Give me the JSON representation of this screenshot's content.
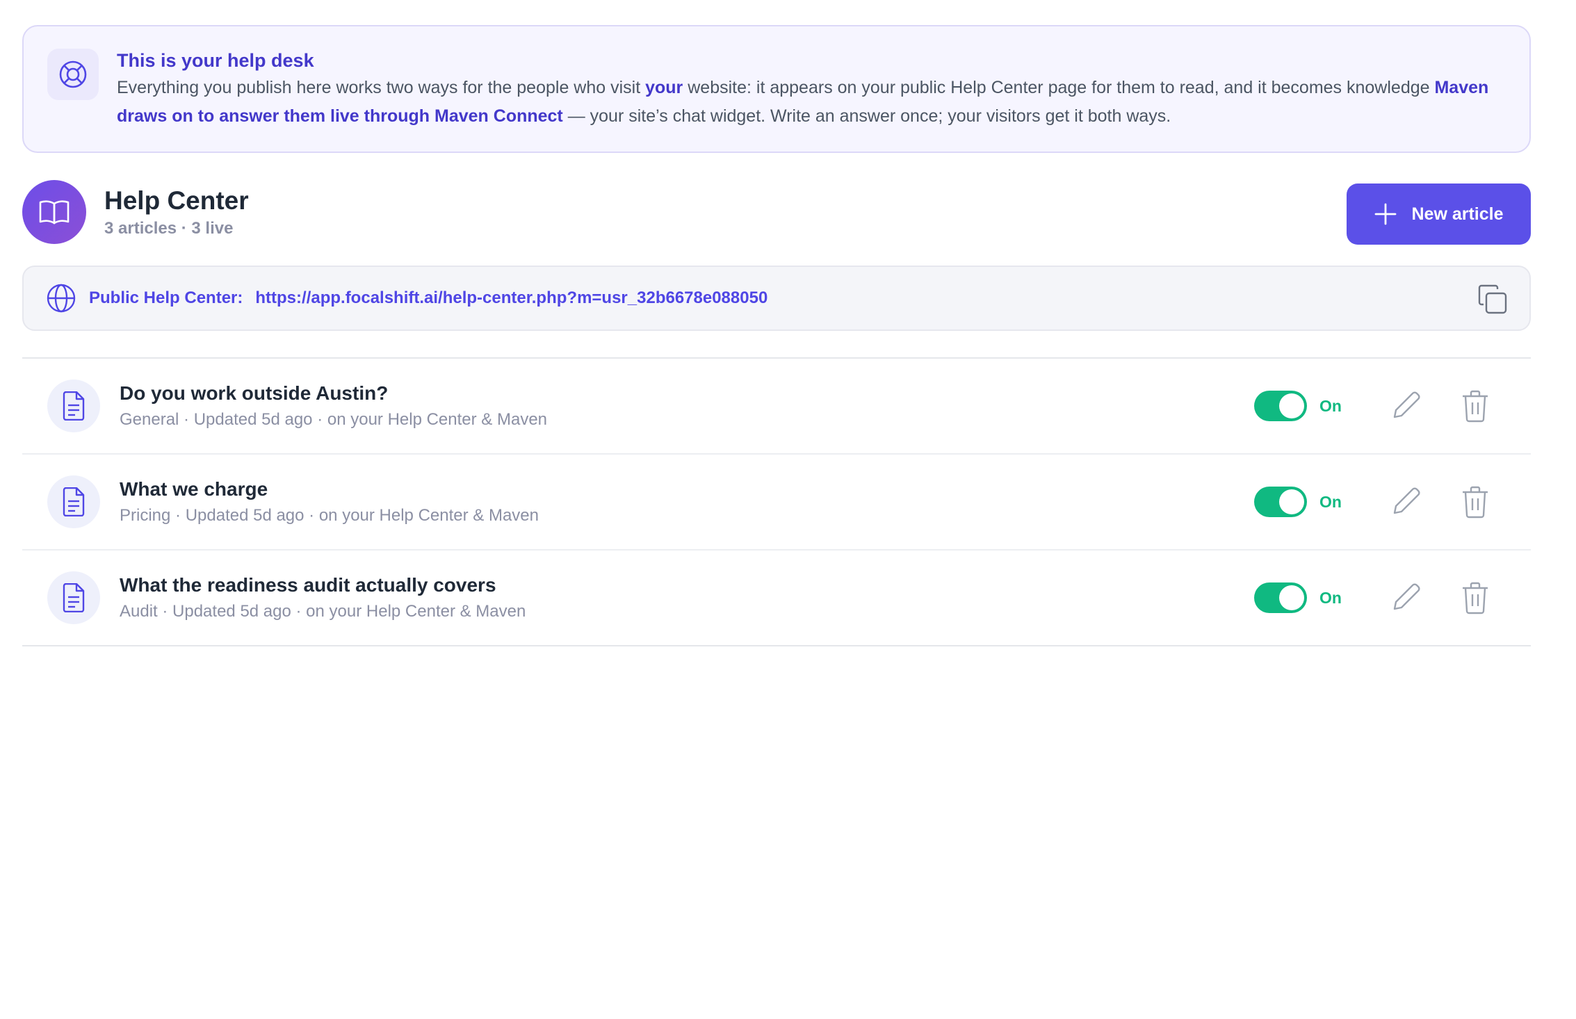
{
  "banner": {
    "icon": "lifebuoy-icon",
    "title": "This is your help desk",
    "body_part1": "Everything you publish here works two ways for the people who visit ",
    "body_em1": "your",
    "body_part2": " website: it appears on your public Help Center page for them to read, and it becomes knowledge ",
    "body_em2": "Maven draws on to answer them live through Maven Connect",
    "body_part3": " — your site’s chat widget. Write an answer once; your visitors get it both ways."
  },
  "header": {
    "icon": "book-icon",
    "title": "Help Center",
    "subtitle": "3 articles · 3 live",
    "new_button_label": "New article"
  },
  "public_url": {
    "icon": "globe-icon",
    "label": "Public Help Center:",
    "url": "https://app.focalshift.ai/help-center.php?m=usr_32b6678e088050",
    "copy_icon": "copy-icon"
  },
  "articles": [
    {
      "title": "Do you work outside Austin?",
      "meta": "General · Updated 5d ago · on your Help Center & Maven",
      "status": "On"
    },
    {
      "title": "What we charge",
      "meta": "Pricing · Updated 5d ago · on your Help Center & Maven",
      "status": "On"
    },
    {
      "title": "What the readiness audit actually covers",
      "meta": "Audit · Updated 5d ago · on your Help Center & Maven",
      "status": "On"
    }
  ],
  "colors": {
    "accent": "#5b50e8",
    "accent_text": "#4338ca",
    "toggle_on": "#10b981",
    "muted_text": "#8b8fa3",
    "banner_bg": "#f6f5ff"
  }
}
